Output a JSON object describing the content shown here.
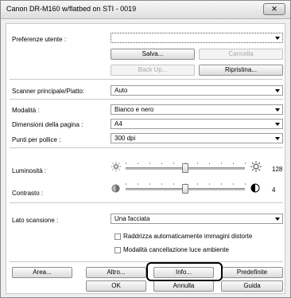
{
  "window": {
    "title": "Canon DR-M160 w/flatbed on STI - 0019",
    "close_label": "✕"
  },
  "settings": {
    "label": "Preferenze utente :",
    "value": "",
    "save_label": "Salva...",
    "cancel_label": "Cancella",
    "backup_label": "Back Up...",
    "restore_label": "Ripristina..."
  },
  "scanner": {
    "label": "Scanner principale/Piatto:",
    "value": "Auto"
  },
  "mode": {
    "label": "Modalità :",
    "value": "Bianco e nero"
  },
  "page_size": {
    "label": "Dimensioni della pagina :",
    "value": "A4"
  },
  "dpi": {
    "label": "Punti per pollice :",
    "value": "300 dpi"
  },
  "brightness": {
    "label": "Luminosità :",
    "value": "128",
    "level": 0.5
  },
  "contrast": {
    "label": "Contrasto :",
    "value": "4",
    "level": 0.5
  },
  "scan_side": {
    "label": "Lato scansione :",
    "value": "Una facciata"
  },
  "options": {
    "deskew_label": "Raddrizza automaticamente immagini distorte",
    "deskew_checked": false,
    "dropout_label": "Modalità cancellazione luce ambiente",
    "dropout_checked": false
  },
  "buttons": {
    "area": "Area...",
    "other": "Altro...",
    "info": "Info...",
    "defaults": "Predefinite",
    "ok": "OK",
    "cancel": "Annulla",
    "help": "Guida"
  }
}
